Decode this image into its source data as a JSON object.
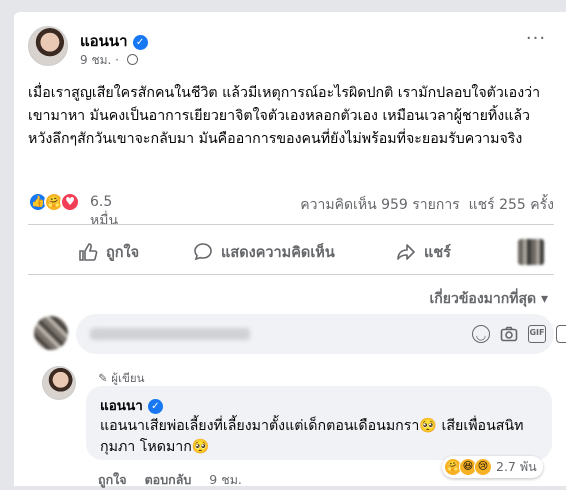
{
  "post": {
    "author": "แอนนา",
    "time": "9 ชม.",
    "time_separator": "·",
    "text": "เมื่อเราสูญเสียใครสักคนในชีวิต แล้วมีเหตุการณ์อะไรผิดปกติ เรามักปลอบใจตัวเองว่าเขามาหา มันคงเป็นอาการเยียวยาจิตใจตัวเองหลอกตัวเอง เหมือนเวลาผู้ชายทิ้งแล้วหวังลึกๆสักวันเขาจะกลับมา มันคืออาการของคนที่ยังไม่พร้อมที่จะยอมรับความจริง",
    "more_icon": "···"
  },
  "stats": {
    "reaction_count": "6.5 หมื่น",
    "comments": "ความคิดเห็น 959 รายการ",
    "shares": "แชร์ 255 ครั้ง",
    "reaction_icons": [
      "like-icon",
      "care-icon",
      "love-icon"
    ]
  },
  "actions": {
    "like": "ถูกใจ",
    "comment": "แสดงความคิดเห็น",
    "share": "แชร์"
  },
  "sort": {
    "label": "เกี่ยวข้องมากที่สุด",
    "arrow": "▾"
  },
  "comment_box": {
    "tools": [
      "emoji-icon",
      "camera-icon",
      "gif-icon",
      "sticker-icon"
    ],
    "gif_label": "GIF"
  },
  "comment": {
    "author_tag": "ผู้เขียน",
    "author": "แอนนา",
    "text": "แอนนาเสียพ่อเลี้ยงที่เลี้ยงมาตั้งแต่เด็กตอนเดือนมกรา🥺 เสียเพื่อนสนิทกุมภา โหดมาก🥺",
    "like": "ถูกใจ",
    "reply": "ตอบกลับ",
    "time": "9 ชม.",
    "reaction_count": "2.7 พัน",
    "reaction_icons": [
      "care-icon",
      "haha-icon",
      "sad-icon"
    ]
  },
  "colors": {
    "accent": "#1877f2",
    "secondary_text": "#65676b",
    "bubble": "#f0f2f5"
  }
}
